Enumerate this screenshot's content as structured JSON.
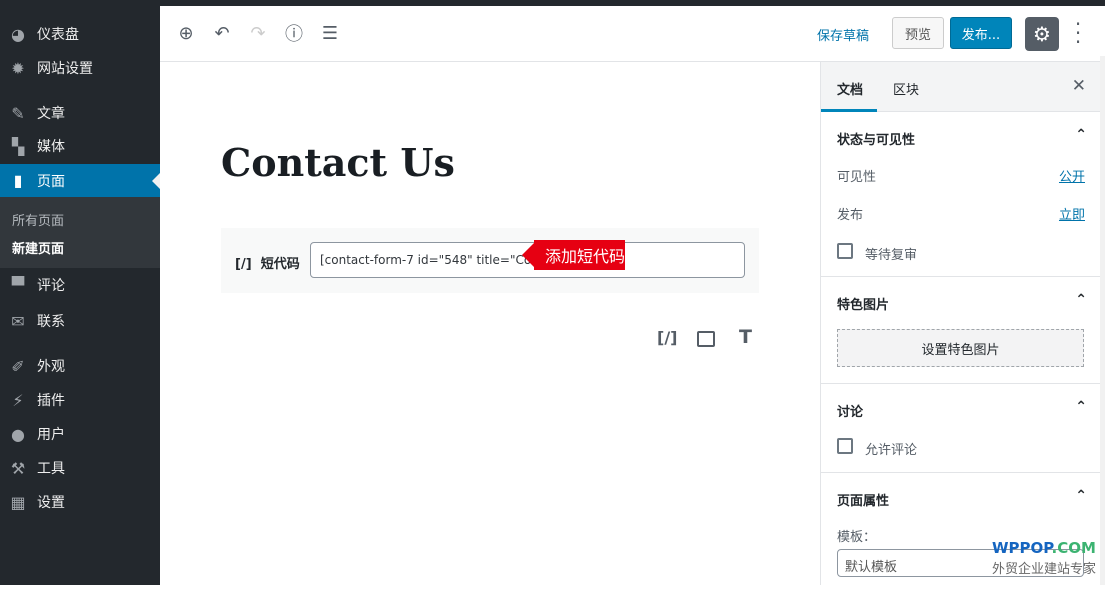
{
  "sidebar": {
    "items": [
      {
        "label": "仪表盘",
        "icon": "dashboard-icon"
      },
      {
        "label": "网站设置",
        "icon": "gear-icon"
      },
      {
        "label": "文章",
        "icon": "pin-icon"
      },
      {
        "label": "媒体",
        "icon": "media-icon"
      },
      {
        "label": "页面",
        "icon": "page-icon",
        "active": true
      },
      {
        "label": "评论",
        "icon": "comment-icon"
      },
      {
        "label": "联系",
        "icon": "mail-icon"
      },
      {
        "label": "外观",
        "icon": "brush-icon"
      },
      {
        "label": "插件",
        "icon": "plugin-icon"
      },
      {
        "label": "用户",
        "icon": "user-icon"
      },
      {
        "label": "工具",
        "icon": "wrench-icon"
      },
      {
        "label": "设置",
        "icon": "settings-icon"
      }
    ],
    "submenu": [
      "所有页面",
      "新建页面"
    ]
  },
  "toolbar": {
    "save_draft": "保存草稿",
    "preview": "预览",
    "publish": "发布..."
  },
  "editor": {
    "title": "Contact Us",
    "shortcode_label": "短代码",
    "shortcode_icon": "[/]",
    "shortcode_value": "[contact-form-7 id=\"548\" title=\"Contact-Form\"]",
    "annotation": "添加短代码",
    "inserter_icons": [
      "[/]",
      "image-icon",
      "T"
    ]
  },
  "panel": {
    "tabs": [
      "文档",
      "区块"
    ],
    "status": {
      "title": "状态与可见性",
      "visibility_label": "可见性",
      "visibility_value": "公开",
      "publish_label": "发布",
      "publish_value": "立即",
      "pending": "等待复审"
    },
    "featured": {
      "title": "特色图片",
      "button": "设置特色图片"
    },
    "discussion": {
      "title": "讨论",
      "allow_comments": "允许评论"
    },
    "attributes": {
      "title": "页面属性",
      "template_label": "模板：",
      "template_value": "默认模板"
    }
  },
  "watermark": {
    "brand": "WPPOP",
    "tld": ".COM",
    "tagline": "外贸企业建站专家"
  },
  "colors": {
    "accent": "#0073aa",
    "annotation": "#e60012"
  }
}
